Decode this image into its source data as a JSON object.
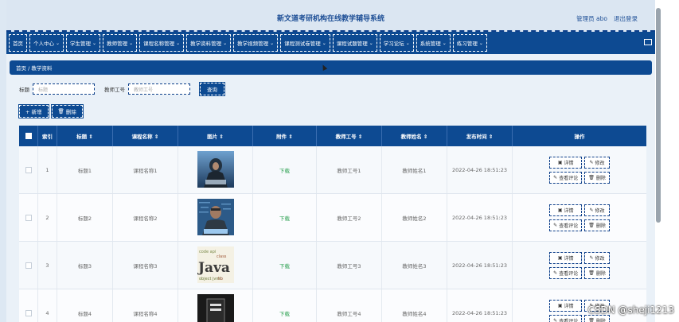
{
  "header": {
    "title": "新文道考研机构在线教学辅导系统",
    "admin": "管理员 abo",
    "logout": "退出登录"
  },
  "nav": [
    {
      "label": "首页",
      "caret": ""
    },
    {
      "label": "个人中心",
      "caret": "⌄"
    },
    {
      "label": "学生管理",
      "caret": "⌄"
    },
    {
      "label": "教师管理",
      "caret": "⌄"
    },
    {
      "label": "课程名称管理",
      "caret": "⌄"
    },
    {
      "label": "教学资料管理",
      "caret": "⌄"
    },
    {
      "label": "教学视频管理",
      "caret": "⌄"
    },
    {
      "label": "课程测试卷管理",
      "caret": "⌄"
    },
    {
      "label": "课程试题管理",
      "caret": "⌄"
    },
    {
      "label": "学习论坛",
      "caret": "⌄"
    },
    {
      "label": "系统管理",
      "caret": "⌄"
    },
    {
      "label": "练习管理",
      "caret": "⌄"
    }
  ],
  "breadcrumb": "首页 / 教学资料",
  "search": {
    "label1": "标题",
    "placeholder1": "标题",
    "label2": "教师工号",
    "placeholder2": "教师工号",
    "button": "查询"
  },
  "actions": {
    "add": "+ 新增",
    "delete": "删除"
  },
  "table": {
    "headers": [
      "索引",
      "标题 ⇕",
      "课程名称 ⇕",
      "图片 ⇕",
      "附件 ⇕",
      "教师工号 ⇕",
      "教师姓名 ⇕",
      "发布时间 ⇕",
      "操作"
    ],
    "rows": [
      {
        "index": "1",
        "title": "标题1",
        "course": "课程名称1",
        "attachment": "下载",
        "teacher_no": "教师工号1",
        "teacher_name": "教师姓名1",
        "time": "2022-04-26 18:51:23",
        "image": "hacker-hooded"
      },
      {
        "index": "2",
        "title": "标题2",
        "course": "课程名称2",
        "attachment": "下载",
        "teacher_no": "教师工号2",
        "teacher_name": "教师姓名2",
        "time": "2022-04-26 18:51:23",
        "image": "programmer-code"
      },
      {
        "index": "3",
        "title": "标题3",
        "course": "课程名称3",
        "attachment": "下载",
        "teacher_no": "教师工号3",
        "teacher_name": "教师姓名3",
        "time": "2022-04-26 18:51:23",
        "image": "java-wordcloud"
      },
      {
        "index": "4",
        "title": "标题4",
        "course": "课程名称4",
        "attachment": "下载",
        "teacher_no": "教师工号4",
        "teacher_name": "教师姓名4",
        "time": "2022-04-26 18:51:23",
        "image": "dark-book"
      }
    ],
    "ops": {
      "detail": "详情",
      "edit": "修改",
      "comments": "查看评论",
      "delete": "删除"
    }
  },
  "watermark": "CSDN @sheji1213"
}
